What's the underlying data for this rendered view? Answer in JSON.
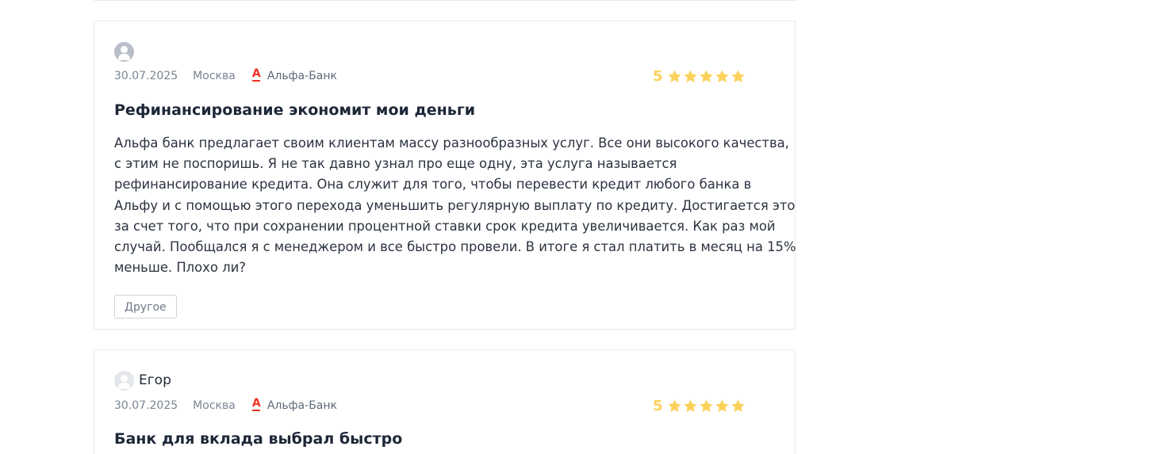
{
  "reviews": [
    {
      "author": "",
      "date": "30.07.2025",
      "city": "Москва",
      "bank": "Альфа-Банк",
      "rating": "5",
      "title": "Рефинансирование экономит мои деньги",
      "text_lines": [
        "Альфа банк предлагает своим клиентам массу разнообразных услуг. Все они высокого качества,",
        "с этим не поспоришь. Я не так давно узнал про еще одну, эта услуга называется",
        "рефинансирование кредита. Она служит для того, чтобы перевести кредит любого банка в",
        "Альфу и с помощью этого перехода уменьшить регулярную выплату по кредиту. Достигается это",
        "за счет того, что при сохранении процентной ставки срок кредита увеличивается. Как раз мой",
        "случай. Пообщался я с менеджером и все быстро провели. В итоге я стал платить в месяц на 15%",
        "меньше. Плохо ли?"
      ],
      "tag": "Другое"
    },
    {
      "author": "Егор",
      "date": "30.07.2025",
      "city": "Москва",
      "bank": "Альфа-Банк",
      "rating": "5",
      "title": "Банк для вклада выбрал быстро"
    }
  ],
  "icons": {
    "bank_logo": "alfa-bank-logo-icon",
    "avatar": "user-avatar-icon",
    "star": "star-icon"
  },
  "colors": {
    "star": "#fcd15b",
    "bank_logo": "#ef3124",
    "border": "#e8eaee"
  }
}
